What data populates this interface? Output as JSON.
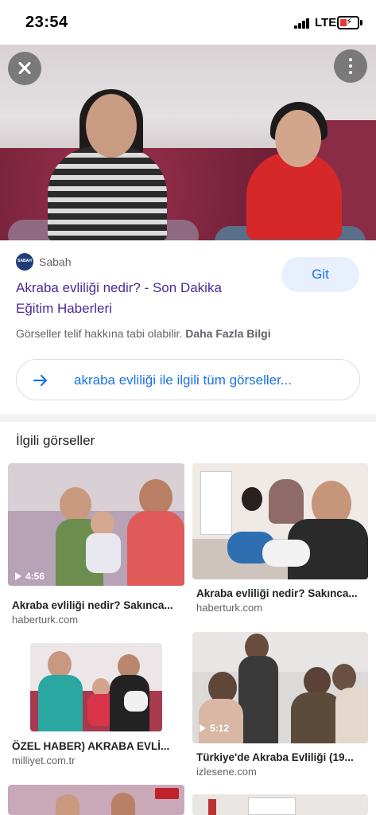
{
  "status_bar": {
    "time": "23:54",
    "network": "LTE"
  },
  "hero": {
    "close_icon": "close-icon",
    "more_icon": "more-vert-icon"
  },
  "result": {
    "source_name": "Sabah",
    "source_logo_text": "SABAH",
    "title": "Akraba evliliği nedir? - Son Dakika Eğitim Haberleri",
    "visit_button": "Git",
    "copyright_text": "Görseller telif hakkına tabi olabilir.",
    "more_info_link": "Daha Fazla Bilgi",
    "all_images_label": "akraba evliliği ile ilgili tüm görseller..."
  },
  "related": {
    "heading": "İlgili görseller",
    "items": [
      {
        "title": "Akraba evliliği nedir? Sakınca...",
        "domain": "haberturk.com",
        "duration": "4:56"
      },
      {
        "title": "Akraba evliliği nedir? Sakınca...",
        "domain": "haberturk.com",
        "duration": ""
      },
      {
        "title": "ÖZEL HABER) AKRABA EVLİ...",
        "domain": "milliyet.com.tr",
        "duration": ""
      },
      {
        "title": "Türkiye'de Akraba Evliliği (19...",
        "domain": "izlesene.com",
        "duration": "5:12"
      }
    ]
  },
  "colors": {
    "accent": "#1a73e8",
    "title_link": "#4a2a9a",
    "battery_low": "#e53935"
  }
}
